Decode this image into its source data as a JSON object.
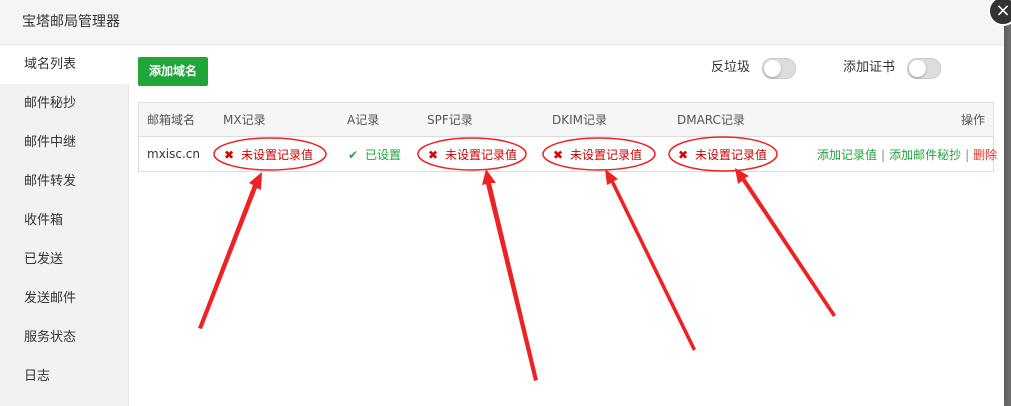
{
  "dialog": {
    "title": "宝塔邮局管理器",
    "close_glyph": "×"
  },
  "sidebar": {
    "items": [
      {
        "label": "域名列表",
        "active": true
      },
      {
        "label": "邮件秘抄"
      },
      {
        "label": "邮件中继"
      },
      {
        "label": "邮件转发"
      },
      {
        "label": "收件箱"
      },
      {
        "label": "已发送"
      },
      {
        "label": "发送邮件"
      },
      {
        "label": "服务状态"
      },
      {
        "label": "日志"
      }
    ]
  },
  "toolbar": {
    "add_domain_label": "添加域名",
    "spam_label": "反垃圾",
    "spam_enabled": false,
    "cert_label": "添加证书",
    "cert_enabled": false
  },
  "table": {
    "headers": [
      "邮箱域名",
      "MX记录",
      "A记录",
      "SPF记录",
      "DKIM记录",
      "DMARC记录",
      "操作"
    ],
    "rows": [
      {
        "domain": "mxisc.cn",
        "mx": {
          "text": "未设置记录值",
          "ok": false
        },
        "a": {
          "text": "已设置",
          "ok": true
        },
        "spf": {
          "text": "未设置记录值",
          "ok": false
        },
        "dkim": {
          "text": "未设置记录值",
          "ok": false
        },
        "dmarc": {
          "text": "未设置记录值",
          "ok": false
        },
        "actions": {
          "add_record": "添加记录值",
          "add_bcc": "添加邮件秘抄",
          "delete": "删除",
          "sep": "|"
        }
      }
    ]
  },
  "icons": {
    "cross": "✖",
    "check": "✔"
  },
  "colors": {
    "accent": "#20a53a",
    "error": "#dd0000",
    "annotation": "#ee2222"
  }
}
